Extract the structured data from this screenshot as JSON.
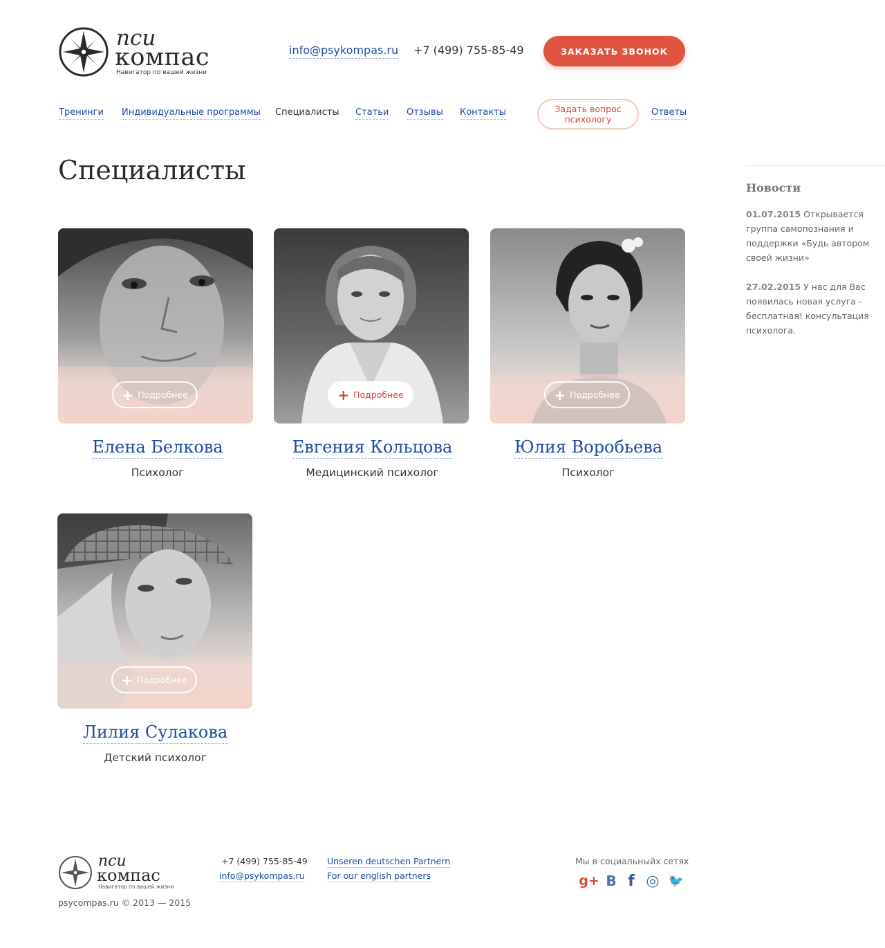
{
  "header": {
    "logo": {
      "word1": "пси",
      "word2": "компас",
      "tagline": "Навигатор по вашей жизни"
    },
    "email": "info@psykompas.ru",
    "phone": "+7 (499) 755-85-49",
    "call_button": "ЗАКАЗАТЬ ЗВОНОК"
  },
  "nav": {
    "items": [
      {
        "label": "Тренинги"
      },
      {
        "label": "Индивидуальные программы"
      },
      {
        "label": "Специалисты",
        "active": true
      },
      {
        "label": "Статьи"
      },
      {
        "label": "Отзывы"
      },
      {
        "label": "Контакты"
      }
    ],
    "ask_button": "Задать вопрос психологу",
    "answers": "Ответы"
  },
  "page_title": "Специалисты",
  "sidebar": {
    "title": "Новости",
    "news": [
      {
        "date": "01.07.2015",
        "text": "Открывается группа самопознания и поддержки «Будь автором своей жизни»"
      },
      {
        "date": "27.02.2015",
        "text": "У нас для Вас появилась новая услуга - бесплатная! консультация психолога."
      }
    ]
  },
  "specialists": [
    {
      "name": "Елена Белкова",
      "role": "Психолог",
      "more": "Подробнее"
    },
    {
      "name": "Евгения Кольцова",
      "role": "Медицинский психолог",
      "more": "Подробнее"
    },
    {
      "name": "Юлия Воробьева",
      "role": "Психолог",
      "more": "Подробнее"
    },
    {
      "name": "Лилия Сулакова",
      "role": "Детский психолог",
      "more": "Подробнее"
    }
  ],
  "footer": {
    "phone": "+7 (499) 755-85-49",
    "email": "info@psykompas.ru",
    "partner_de": "Unseren deutschen Partnern",
    "partner_en": "For our english partners",
    "social_label": "Мы в социальныйх сетях",
    "copyright": "psycompas.ru © 2013 — 2015",
    "social": [
      {
        "icon": "google-plus-icon",
        "glyph": "g+",
        "color": "#dd4b39"
      },
      {
        "icon": "vk-icon",
        "glyph": "В",
        "color": "#4a76a8"
      },
      {
        "icon": "facebook-icon",
        "glyph": "f",
        "color": "#3b5998"
      },
      {
        "icon": "instagram-icon",
        "glyph": "◎",
        "color": "#3f729b"
      },
      {
        "icon": "twitter-icon",
        "glyph": "🐦",
        "color": "#1da1f2"
      }
    ]
  },
  "colors": {
    "accent": "#e0543f",
    "link": "#1e4aa3",
    "photo_tint": "#f3d3c9"
  }
}
